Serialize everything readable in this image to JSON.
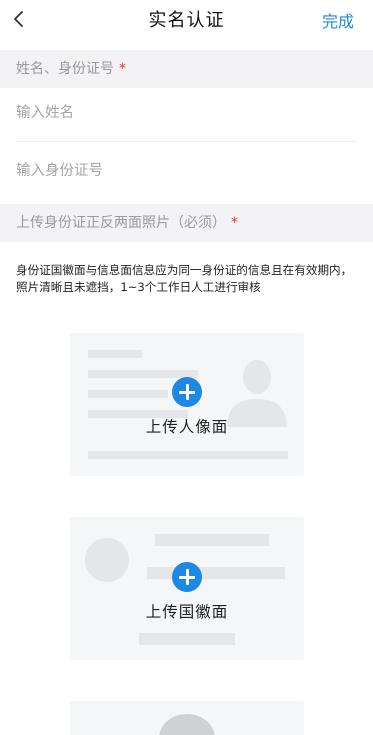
{
  "header": {
    "title": "实名认证",
    "done_label": "完成",
    "back_icon": "chevron-left-icon"
  },
  "section_identity": {
    "title": "姓名、身份证号",
    "required_mark": "*"
  },
  "name_input": {
    "placeholder": "输入姓名",
    "value": ""
  },
  "id_input": {
    "placeholder": "输入身份证号",
    "value": ""
  },
  "section_upload": {
    "title": "上传身份证正反两面照片（必须）",
    "required_mark": "*"
  },
  "notice": "身份证国徽面与信息面信息应为同一身份证的信息且在有效期内，照片清晰且未遮挡，1~3个工作日人工进行审核",
  "upload_portrait": {
    "label": "上传人像面",
    "icon": "add-icon"
  },
  "upload_emblem": {
    "label": "上传国徽面",
    "icon": "add-icon"
  },
  "colors": {
    "accent": "#1e88e5",
    "required": "#e53935",
    "section_bg": "#f3f3f5",
    "placeholder": "#a5a5a5"
  }
}
